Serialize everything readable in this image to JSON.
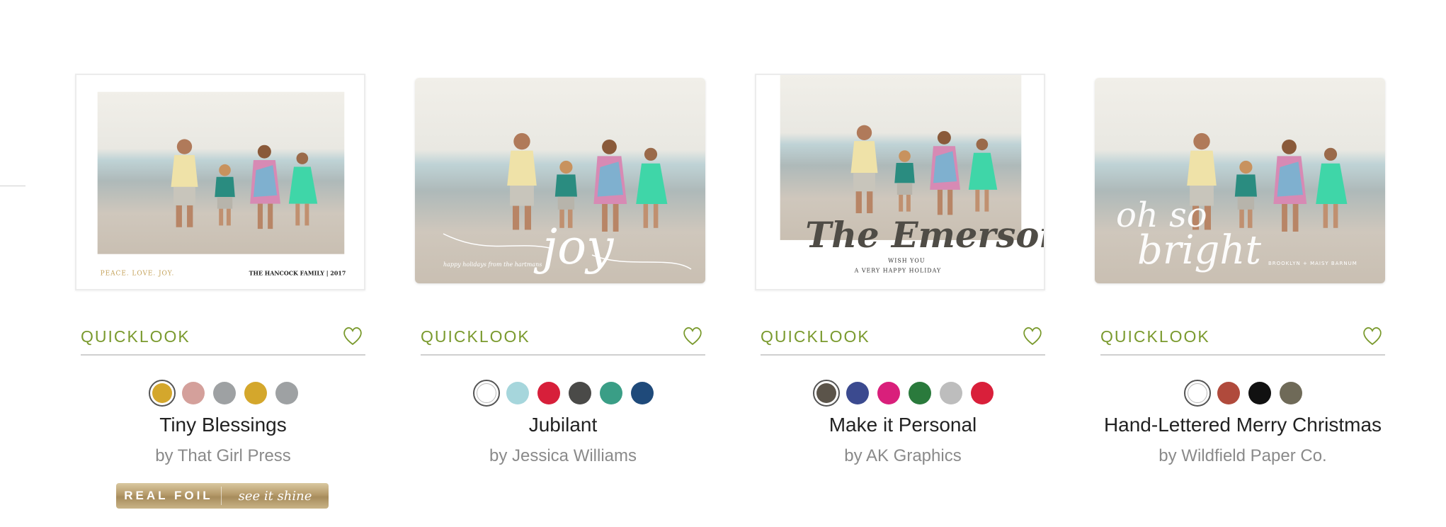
{
  "quicklook_label": "QUICKLOOK",
  "products": [
    {
      "title": "Tiny Blessings",
      "byline": "by That Girl Press",
      "swatches": [
        "#d4a72c",
        "#d4a09b",
        "#9ea1a3",
        "#d4a72c",
        "#9ea1a3"
      ],
      "selected": 0,
      "badge": {
        "left": "REAL FOIL",
        "right": "see it shine"
      },
      "card_text": {
        "left": "PEACE. LOVE. JOY.",
        "right": "THE HANCOCK FAMILY | 2017"
      }
    },
    {
      "title": "Jubilant",
      "byline": "by Jessica Williams",
      "swatches": [
        "#ffffff",
        "#a6d6dc",
        "#d71f3a",
        "#4a4a48",
        "#3a9e86",
        "#1f4a7a"
      ],
      "selected": 0,
      "card_text": {
        "script": "joy",
        "small": "happy holidays from the hartmans"
      }
    },
    {
      "title": "Make it Personal",
      "byline": "by AK Graphics",
      "swatches": [
        "#5b544a",
        "#3b4a8f",
        "#d91f7b",
        "#2a7a3c",
        "#bdbdbd",
        "#d91f3a"
      ],
      "selected": 0,
      "card_text": {
        "script": "The Emersons",
        "small1": "WISH YOU",
        "small2": "A VERY HAPPY HOLIDAY"
      }
    },
    {
      "title": "Hand-Lettered Merry Christmas",
      "byline": "by Wildfield Paper Co.",
      "swatches": [
        "#ffffff",
        "#b04a3c",
        "#111111",
        "#6f6a58"
      ],
      "selected": 0,
      "card_text": {
        "script1": "oh so",
        "script2": "bright",
        "small": "BROOKLYN + MAISY BARNUM"
      }
    }
  ],
  "colors": {
    "accent": "#7a9a2e",
    "rule": "#cfcfcf",
    "byline": "#8a8a8a"
  }
}
